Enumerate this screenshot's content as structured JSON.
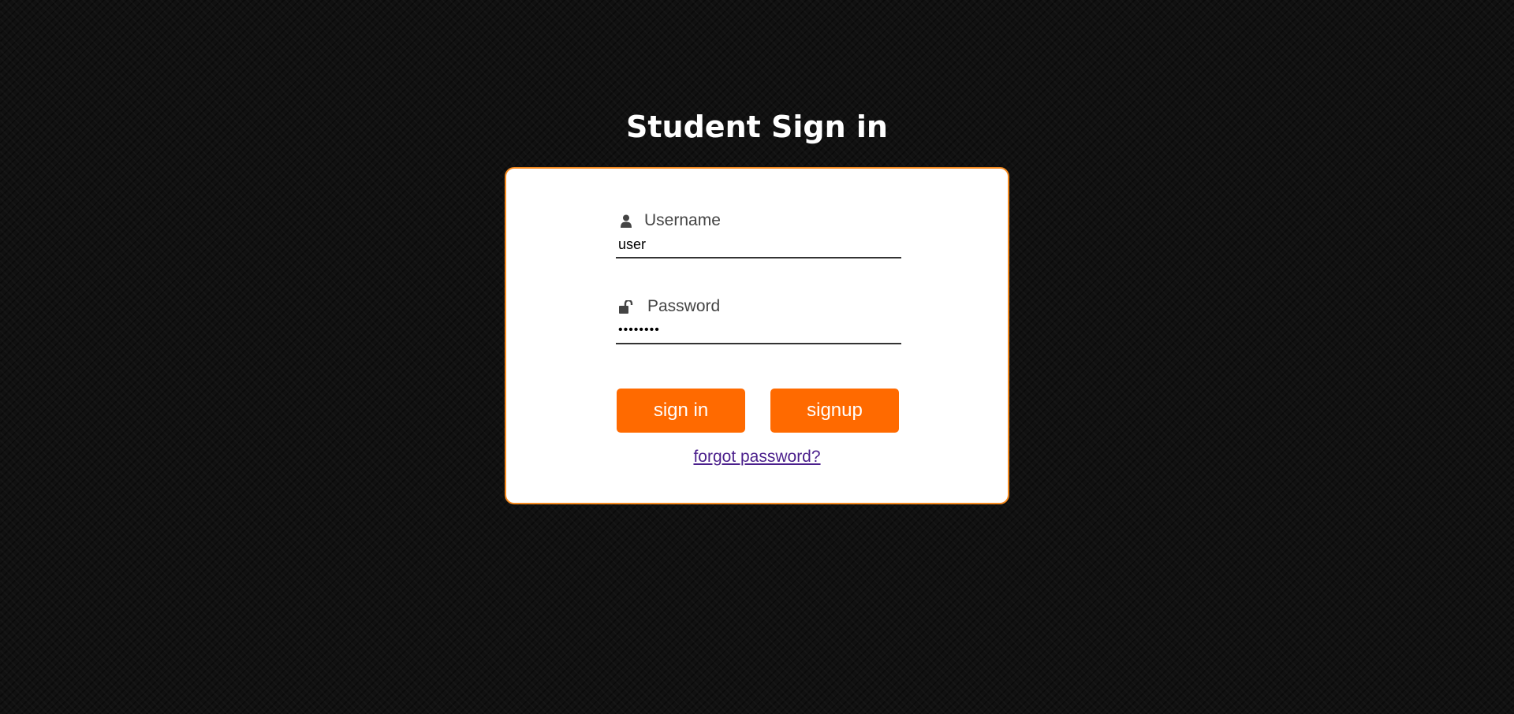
{
  "page": {
    "title": "Student Sign in"
  },
  "form": {
    "username": {
      "label": "Username",
      "value": "user",
      "icon": "user-icon"
    },
    "password": {
      "label": "Password",
      "value": "password",
      "icon": "unlock-icon"
    },
    "signin_label": "sign in",
    "signup_label": "signup",
    "forgot_label": "forgot password?"
  },
  "colors": {
    "accent": "#ff6a00",
    "card_border": "#f58a1f",
    "background": "#111111",
    "link": "#4b1f8c"
  }
}
